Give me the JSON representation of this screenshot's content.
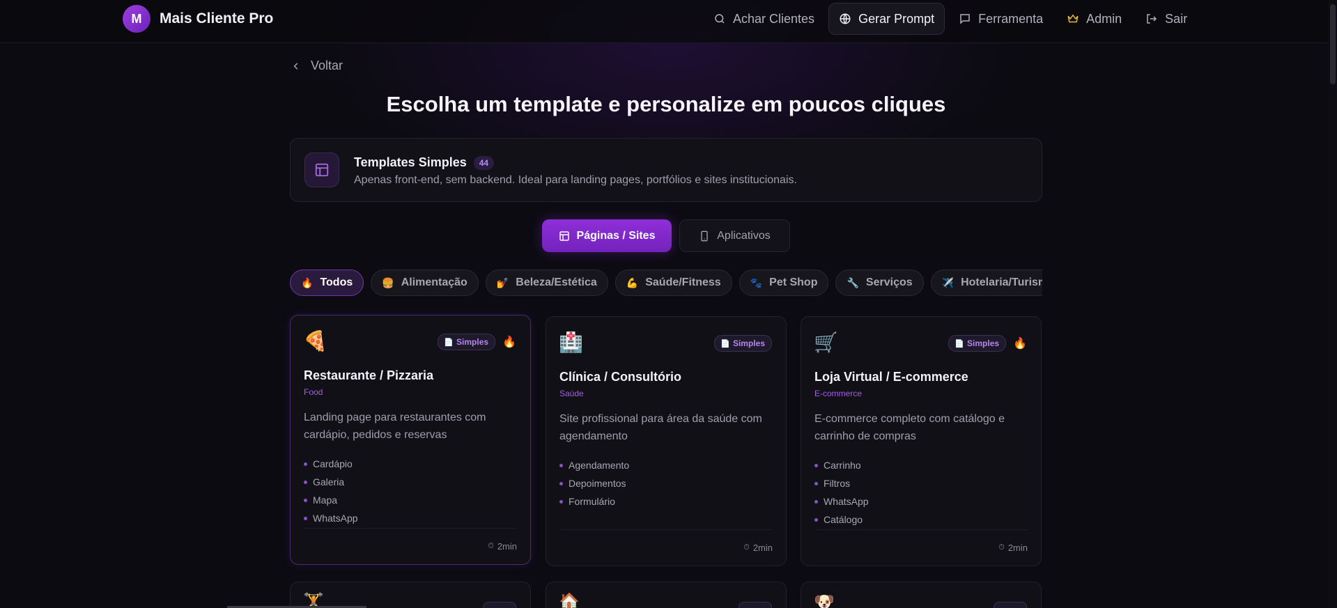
{
  "header": {
    "logo_letter": "M",
    "brand": "Mais Cliente Pro",
    "nav": [
      {
        "label": "Achar Clientes",
        "icon": "search-icon"
      },
      {
        "label": "Gerar Prompt",
        "icon": "globe-icon",
        "active": true
      },
      {
        "label": "Ferramenta",
        "icon": "message-icon"
      },
      {
        "label": "Admin",
        "icon": "crown-icon"
      },
      {
        "label": "Sair",
        "icon": "logout-icon"
      }
    ]
  },
  "back_label": "Voltar",
  "title": "Escolha um template e personalize em poucos cliques",
  "info": {
    "title": "Templates Simples",
    "count": "44",
    "description": "Apenas front-end, sem backend. Ideal para landing pages, portfólios e sites institucionais."
  },
  "toggle": {
    "primary": "Páginas / Sites",
    "secondary": "Aplicativos"
  },
  "filters": [
    {
      "emoji": "🔥",
      "label": "Todos"
    },
    {
      "emoji": "🍔",
      "label": "Alimentação"
    },
    {
      "emoji": "💅",
      "label": "Beleza/Estética"
    },
    {
      "emoji": "💪",
      "label": "Saúde/Fitness"
    },
    {
      "emoji": "🐾",
      "label": "Pet Shop"
    },
    {
      "emoji": "🔧",
      "label": "Serviços"
    },
    {
      "emoji": "✈️",
      "label": "Hotelaria/Turismo"
    }
  ],
  "cards": [
    {
      "emoji": "🍕",
      "badge": "Simples",
      "fire": "🔥",
      "title": "Restaurante / Pizzaria",
      "category": "Food",
      "description": "Landing page para restaurantes com cardápio, pedidos e reservas",
      "features": [
        "Cardápio",
        "Galeria",
        "Mapa",
        "WhatsApp"
      ],
      "time": "2min"
    },
    {
      "emoji": "🏥",
      "badge": "Simples",
      "fire": "",
      "title": "Clínica / Consultório",
      "category": "Saúde",
      "description": "Site profissional para área da saúde com agendamento",
      "features": [
        "Agendamento",
        "Depoimentos",
        "Formulário"
      ],
      "time": "2min"
    },
    {
      "emoji": "🛒",
      "badge": "Simples",
      "fire": "🔥",
      "title": "Loja Virtual / E-commerce",
      "category": "E-commerce",
      "description": "E-commerce completo com catálogo e carrinho de compras",
      "features": [
        "Carrinho",
        "Filtros",
        "WhatsApp",
        "Catálogo"
      ],
      "time": "2min"
    }
  ],
  "partial_cards": [
    {
      "emoji": "🏋️"
    },
    {
      "emoji": "🏠"
    },
    {
      "emoji": "🐶"
    }
  ],
  "icons": {
    "doc": "📄",
    "clock": "⏱"
  },
  "colors": {
    "accent": "#8f2fd8",
    "category": "#a45fe6",
    "admin_crown": "#e8b93a"
  }
}
